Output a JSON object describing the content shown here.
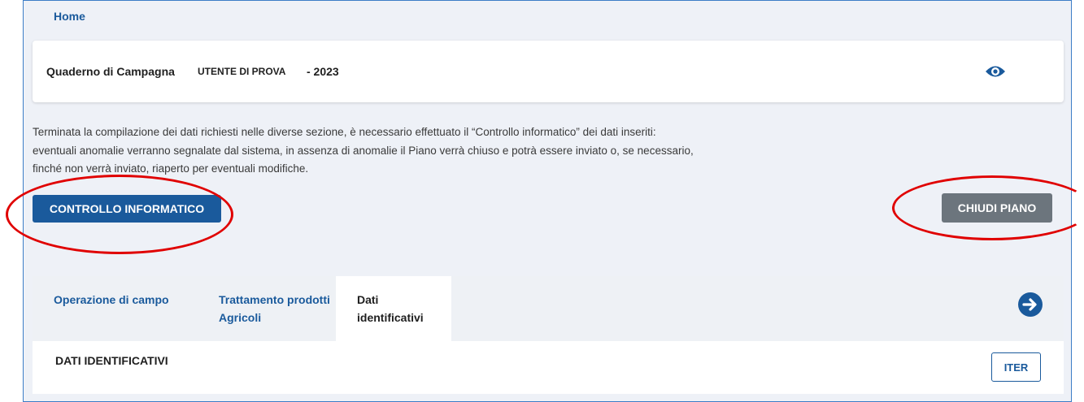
{
  "nav": {
    "home_label": "Home"
  },
  "header": {
    "title": "Quaderno di Campagna",
    "user": "UTENTE DI PROVA",
    "year": "- 2023",
    "view_icon": "eye-icon"
  },
  "info": {
    "lines": [
      "Terminata la compilazione dei dati richiesti nelle diverse sezione, è necessario effettuato il “Controllo informatico” dei dati inseriti:",
      "eventuali anomalie verranno segnalate dal sistema, in assenza di anomalie il Piano verrà chiuso e potrà essere inviato o, se necessario,",
      "finché non verrà inviato, riaperto per eventuali modifiche."
    ]
  },
  "actions": {
    "controllo_label": "CONTROLLO INFORMATICO",
    "chiudi_label": "CHIUDI PIANO"
  },
  "tabs": [
    {
      "label": "Operazione di campo",
      "active": false
    },
    {
      "label": "Trattamento prodotti Agricoli",
      "active": false
    },
    {
      "label": "Dati identificativi",
      "active": true
    }
  ],
  "tabs_next_icon": "arrow-right-circle-icon",
  "section": {
    "title": "DATI IDENTIFICATIVI",
    "iter_label": "ITER"
  },
  "colors": {
    "primary": "#1a5a9c",
    "secondary": "#6c757d",
    "annotation": "#e00000",
    "page_bg": "#eef1f7"
  }
}
